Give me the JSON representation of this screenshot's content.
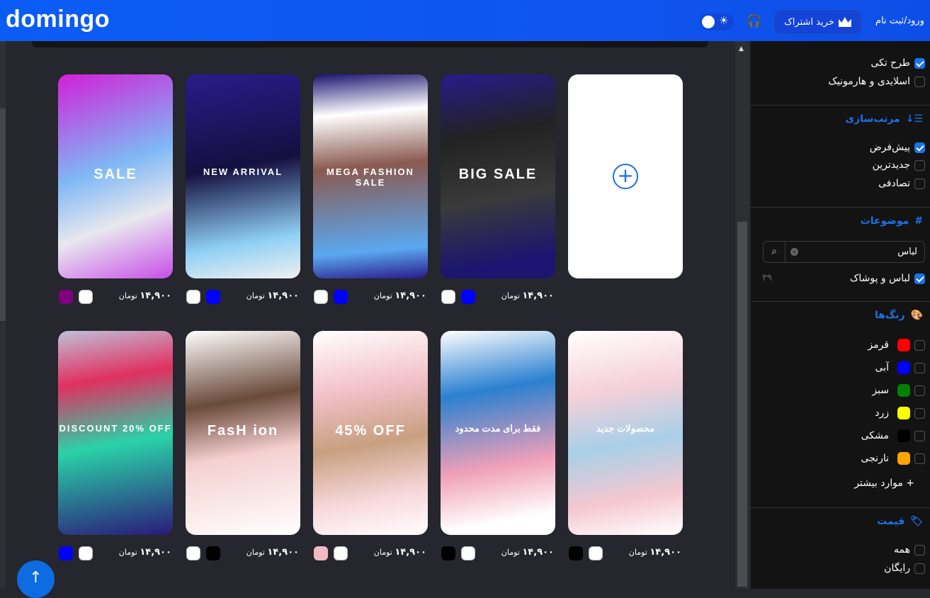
{
  "header": {
    "logo": "domingo",
    "login": "ورود/ثبت نام",
    "subscribe": "خرید اشتراک",
    "icons": [
      "crown-icon",
      "headset-icon",
      "sun-icon"
    ]
  },
  "cards": [
    {
      "caption": "SALE",
      "bg": "linear-gradient(160deg,#d21fd8,#7fb8f5 45%,#e8e8ee 70%,#c84ee8)",
      "price": "۱۴,۹۰۰",
      "currency": "تومان",
      "swatches": [
        "#800080",
        "#ffffff"
      ]
    },
    {
      "caption": "NEW ARRIVAL",
      "bg": "linear-gradient(170deg,#2a1b8a,#151040 45%,#8fd0f5 80%,#f0f0f0)",
      "price": "۱۴,۹۰۰",
      "currency": "تومان",
      "swatches": [
        "#ffffff",
        "#0000ff"
      ]
    },
    {
      "caption": "MEGA FASHION SALE",
      "bg": "linear-gradient(175deg,#1b1470,#fff 20%,#8a5a50 45%,#5aa8f0 85%,#2a1a8a)",
      "price": "۱۴,۹۰۰",
      "currency": "تومان",
      "swatches": [
        "#ffffff",
        "#0000ff"
      ]
    },
    {
      "caption": "BIG SALE",
      "bg": "linear-gradient(170deg,#2a1a8a,#222 30%,#3a3a3a 60%,#1b1470 90%)",
      "price": "۱۴,۹۰۰",
      "currency": "تومان",
      "swatches": [
        "#ffffff",
        "#0000ff"
      ]
    },
    {
      "caption": "DISCOUNT 20% OFF",
      "bg": "linear-gradient(170deg,#c0c0d8,#e03060 25%,#2ad2a8 55%,#2a1a7a)",
      "price": "۱۴,۹۰۰",
      "currency": "تومان",
      "swatches": [
        "#0000ff",
        "#ffffff"
      ]
    },
    {
      "caption": "FasH ion",
      "bg": "linear-gradient(170deg,#fff,#6a4a3a 35%,#f5d0d0 60%,#fff)",
      "price": "۱۴,۹۰۰",
      "currency": "تومان",
      "swatches": [
        "#ffffff",
        "#000000"
      ]
    },
    {
      "caption": "45% OFF",
      "bg": "linear-gradient(170deg,#fff,#f2c0c8 30%,#c8a080 55%,#f8d8dc 80%,#fff)",
      "price": "۱۴,۹۰۰",
      "currency": "تومان",
      "swatches": [
        "#f4b8c0",
        "#ffffff"
      ]
    },
    {
      "caption": "فقط برای مدت محدود",
      "bg": "linear-gradient(170deg,#fff,#2a80d0 30%,#f0a0b8 65%,#fff 90%)",
      "price": "۱۴,۹۰۰",
      "currency": "تومان",
      "swatches": [
        "#000000",
        "#ffffff"
      ]
    },
    {
      "caption": "محصولات جدید",
      "bg": "linear-gradient(170deg,#fff,#f5d0d8 30%,#a8d0e8 55%,#f5c8d0 80%,#fff)",
      "price": "۱۴,۹۰۰",
      "currency": "تومان",
      "swatches": [
        "#000000",
        "#ffffff"
      ]
    }
  ],
  "sidebar": {
    "layout": [
      {
        "label": "طرح تکی",
        "checked": true
      },
      {
        "label": "اسلایدی و هارمونیک",
        "checked": false
      }
    ],
    "sort": {
      "title": "مرتب‌سازی",
      "items": [
        {
          "label": "پیش‌فرض",
          "checked": true
        },
        {
          "label": "جدیدترین",
          "checked": false
        },
        {
          "label": "تصادفی",
          "checked": false
        }
      ]
    },
    "topics": {
      "title": "موضوعات",
      "search_value": "لباس",
      "result": {
        "label": "لباس و پوشاک",
        "checked": true,
        "count": "۳۹"
      }
    },
    "colors": {
      "title": "رنگ‌ها",
      "items": [
        {
          "label": "قرمز",
          "color": "#ff0000"
        },
        {
          "label": "آبی",
          "color": "#0000ff"
        },
        {
          "label": "سبز",
          "color": "#008000"
        },
        {
          "label": "زرد",
          "color": "#ffff00"
        },
        {
          "label": "مشکی",
          "color": "#000000"
        },
        {
          "label": "نارنجی",
          "color": "#ffa500"
        }
      ],
      "more": "+ موارد بیشتر"
    },
    "price": {
      "title": "قیمت",
      "items": [
        {
          "label": "همه",
          "checked": false
        },
        {
          "label": "رایگان",
          "checked": false
        }
      ]
    }
  }
}
